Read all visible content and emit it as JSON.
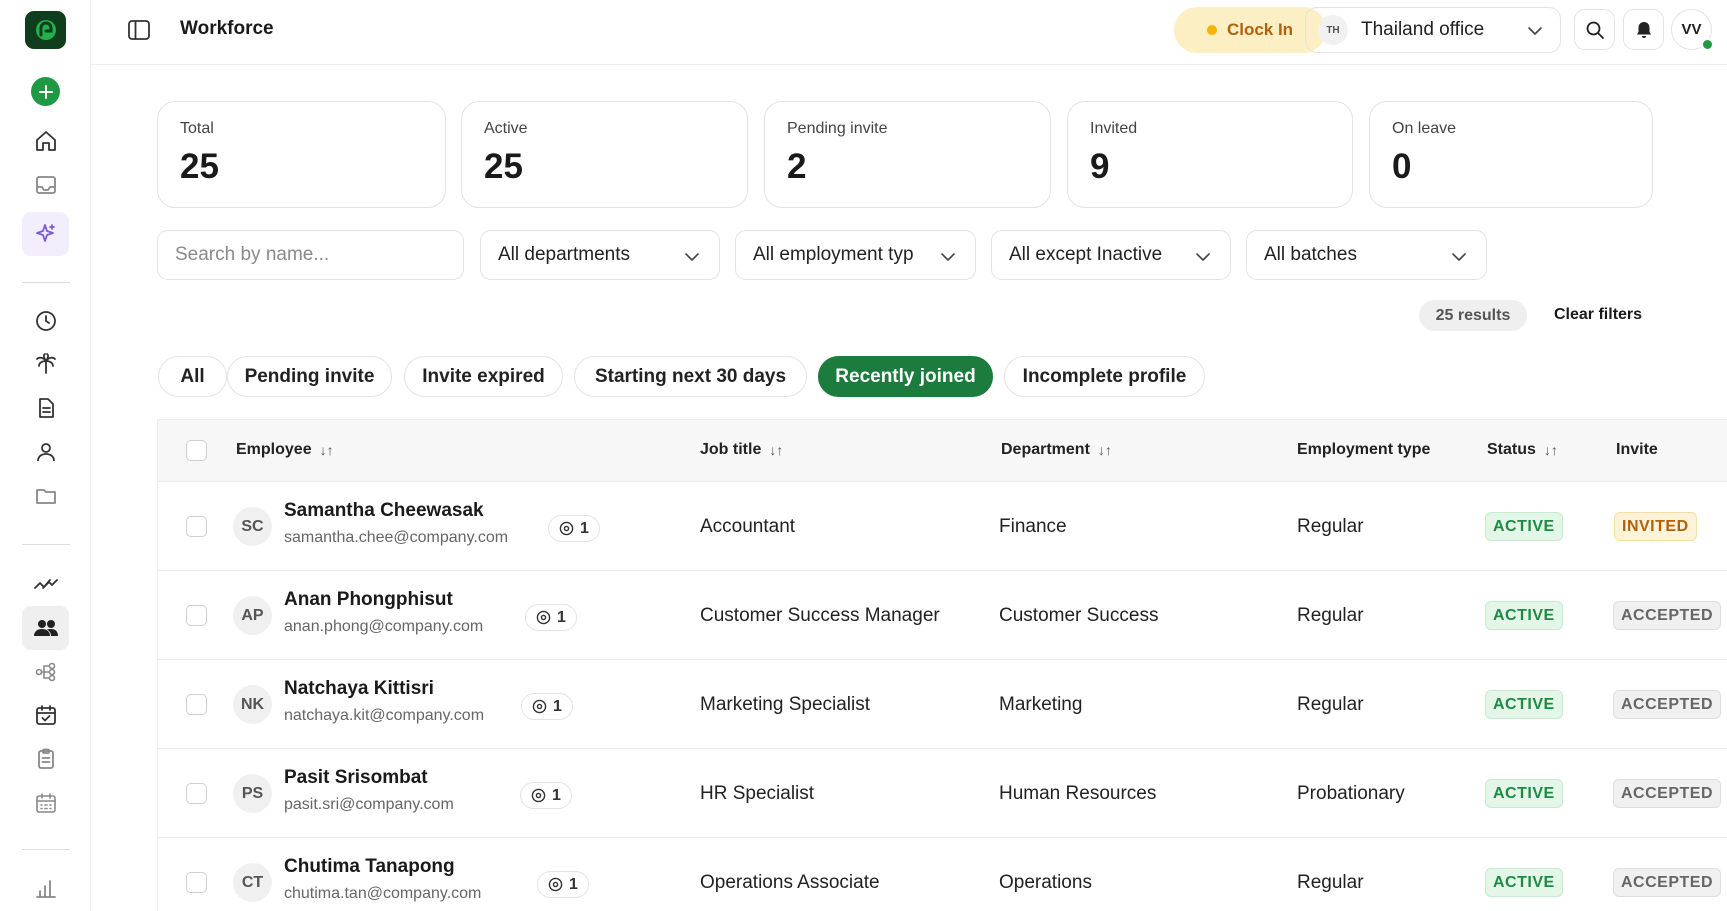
{
  "header": {
    "title": "Workforce",
    "clock_in_label": "Clock In",
    "office_code": "TH",
    "office_name": "Thailand office",
    "user_initials": "VV"
  },
  "stats": [
    {
      "label": "Total",
      "value": "25"
    },
    {
      "label": "Active",
      "value": "25"
    },
    {
      "label": "Pending invite",
      "value": "2"
    },
    {
      "label": "Invited",
      "value": "9"
    },
    {
      "label": "On leave",
      "value": "0"
    }
  ],
  "filters": {
    "search_placeholder": "Search by name...",
    "department": "All departments",
    "employment_type": "All employment typ",
    "status": "All except Inactive",
    "batches": "All batches",
    "results": "25 results",
    "clear_label": "Clear filters"
  },
  "tabs": [
    "All",
    "Pending invite",
    "Invite expired",
    "Starting next 30 days",
    "Recently joined",
    "Incomplete profile"
  ],
  "active_tab": "Recently joined",
  "table": {
    "columns": [
      "Employee",
      "Job title",
      "Department",
      "Employment type",
      "Status",
      "Invite"
    ],
    "rows": [
      {
        "initials": "SC",
        "name": "Samantha Cheewasak",
        "email": "samantha.chee@company.com",
        "views": "1",
        "job": "Accountant",
        "department": "Finance",
        "type": "Regular",
        "status": "ACTIVE",
        "invite": "INVITED"
      },
      {
        "initials": "AP",
        "name": "Anan Phongphisut",
        "email": "anan.phong@company.com",
        "views": "1",
        "job": "Customer Success Manager",
        "department": "Customer Success",
        "type": "Regular",
        "status": "ACTIVE",
        "invite": "ACCEPTED"
      },
      {
        "initials": "NK",
        "name": "Natchaya Kittisri",
        "email": "natchaya.kit@company.com",
        "views": "1",
        "job": "Marketing Specialist",
        "department": "Marketing",
        "type": "Regular",
        "status": "ACTIVE",
        "invite": "ACCEPTED"
      },
      {
        "initials": "PS",
        "name": "Pasit Srisombat",
        "email": "pasit.sri@company.com",
        "views": "1",
        "job": "HR Specialist",
        "department": "Human Resources",
        "type": "Probationary",
        "status": "ACTIVE",
        "invite": "ACCEPTED"
      },
      {
        "initials": "CT",
        "name": "Chutima Tanapong",
        "email": "chutima.tan@company.com",
        "views": "1",
        "job": "Operations Associate",
        "department": "Operations",
        "type": "Regular",
        "status": "ACTIVE",
        "invite": "ACCEPTED"
      }
    ]
  },
  "sidebar": {
    "icons": [
      "add-icon",
      "home-icon",
      "inbox-icon",
      "sparkle-icon",
      "clock-icon",
      "palm-tree-icon",
      "document-icon",
      "user-icon",
      "folder-icon",
      "analytics-icon",
      "people-icon",
      "org-chart-icon",
      "calendar-check-icon",
      "clipboard-icon",
      "calendar-icon",
      "bar-chart-icon"
    ]
  },
  "colors": {
    "brand_green": "#1c7c3d",
    "clock_in_bg": "#fcefc4",
    "clock_in_text": "#b3600d",
    "status_active": "#1f8a45",
    "invite_invited": "#b3600d",
    "accent_purple": "#7c5cd6"
  }
}
